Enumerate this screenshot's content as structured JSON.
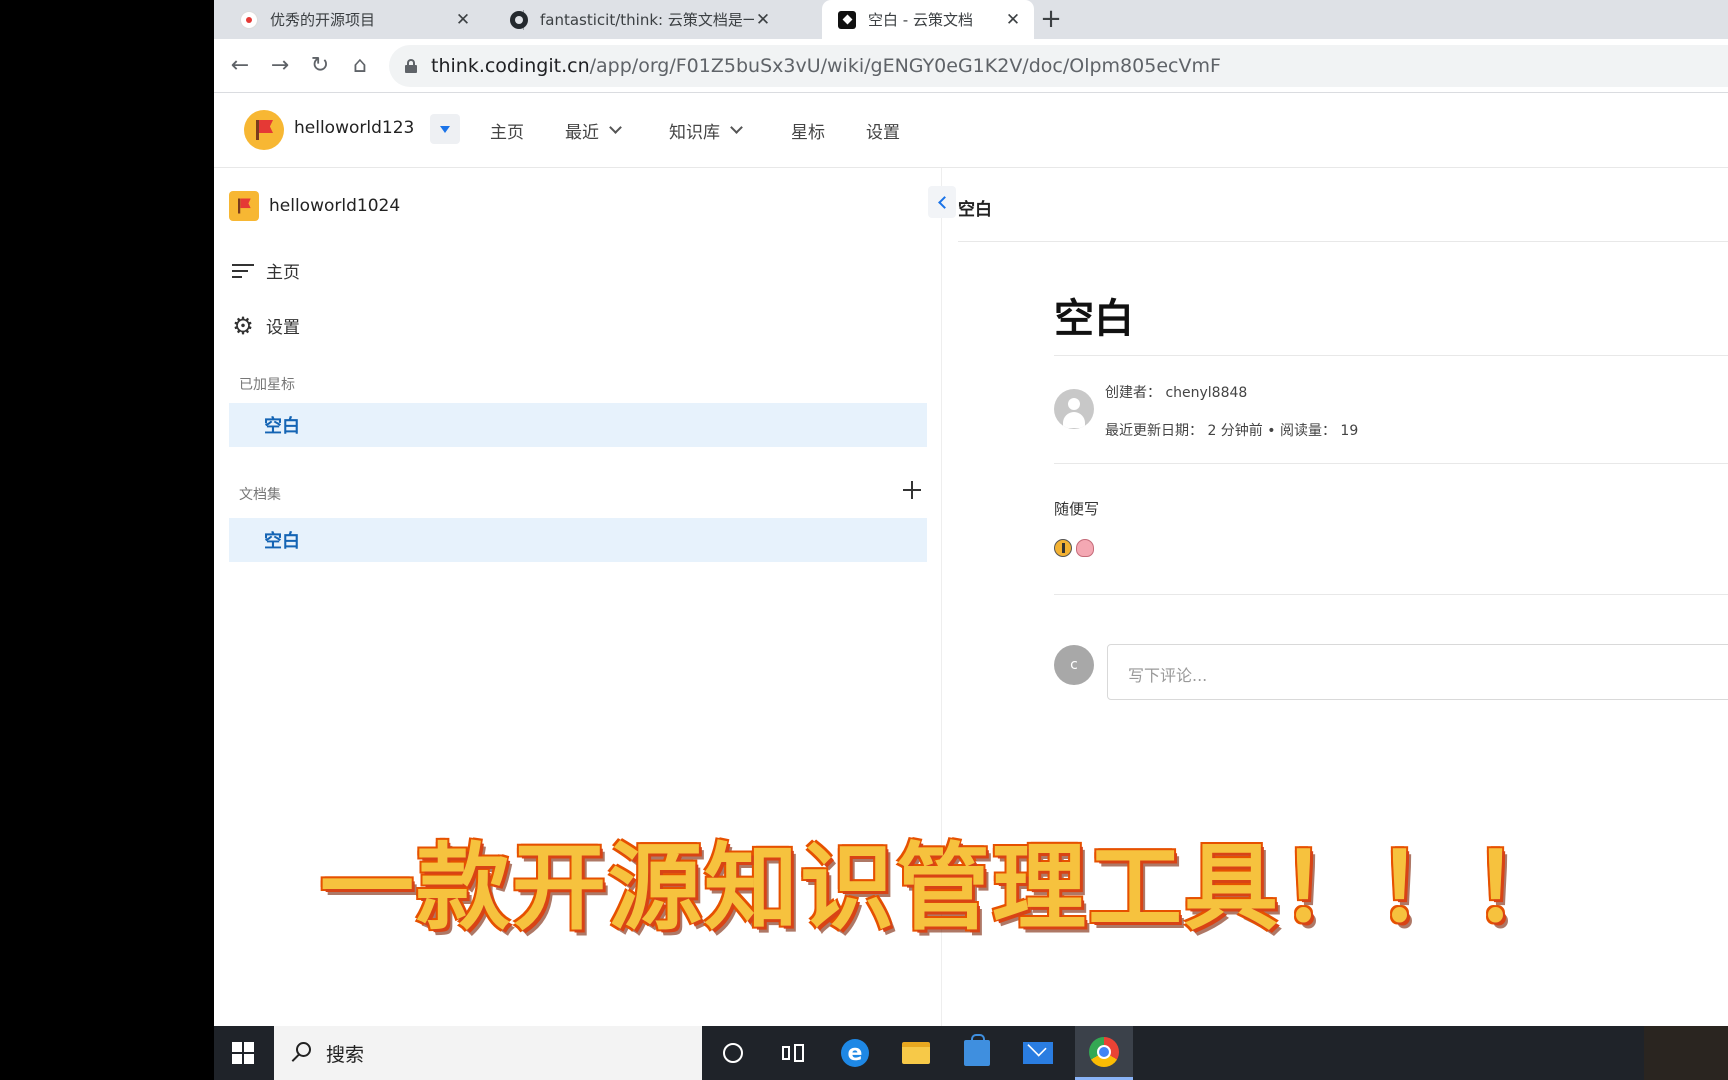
{
  "browser": {
    "tabs": [
      {
        "title": "优秀的开源项目",
        "close": "✕"
      },
      {
        "title": "fantasticit/think: 云策文档是一",
        "close": "✕"
      },
      {
        "title": "空白 - 云策文档",
        "close": "✕"
      }
    ],
    "new_tab": "+",
    "url_host": "think.codingit.cn",
    "url_path": "/app/org/F01Z5buSx3vU/wiki/gENGY0eG1K2V/doc/Olpm805ecVmF",
    "nav": {
      "back": "←",
      "forward": "→",
      "reload": "↻",
      "home": "⌂"
    }
  },
  "header": {
    "org_name": "helloworld123",
    "nav": [
      "主页",
      "最近",
      "知识库",
      "星标",
      "设置"
    ]
  },
  "sidebar": {
    "workspace_name": "helloworld1024",
    "home_label": "主页",
    "settings_label": "设置",
    "starred_label": "已加星标",
    "starred_item": "空白",
    "docset_label": "文档集",
    "docset_item": "空白"
  },
  "main": {
    "breadcrumb": "空白",
    "title": "空白",
    "creator_line": "创建者：  chenyl8848",
    "updated_line": "最近更新日期：  2 分钟前 • 阅读量：  19",
    "body_text": "随便写",
    "comment_avatar_initial": "c",
    "comment_placeholder": "写下评论..."
  },
  "caption": "一款开源知识管理工具！！！",
  "taskbar": {
    "search_label": "搜索"
  },
  "colors": {
    "accent": "#1a73e8",
    "active_item_bg": "#e7f2fc",
    "active_item_text": "#1464b4",
    "caption_fill": "#f6c23e",
    "caption_outline": "#d84315"
  }
}
